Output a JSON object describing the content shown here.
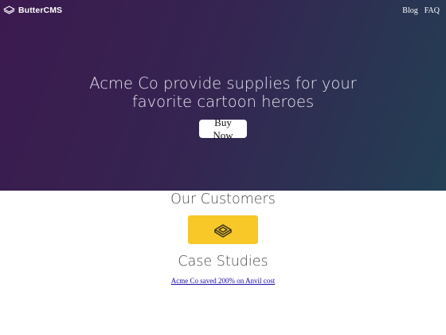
{
  "header": {
    "brand_name": "ButterCMS",
    "brand_icon": "buttercms-logo-icon",
    "nav": [
      {
        "label": "Blog"
      },
      {
        "label": "FAQ"
      }
    ]
  },
  "hero": {
    "title": "Acme Co provide supplies for your favorite cartoon heroes",
    "cta_label": "Buy Now",
    "gradient": [
      "#3c1a50",
      "#233f54"
    ]
  },
  "customers": {
    "title": "Our Customers",
    "logo_icon": "customer-logo-icon",
    "logo_bg": "#f8c828"
  },
  "case_studies": {
    "title": "Case Studies",
    "items": [
      {
        "label": "Acme Co saved 200% on Anvil cost"
      }
    ]
  }
}
